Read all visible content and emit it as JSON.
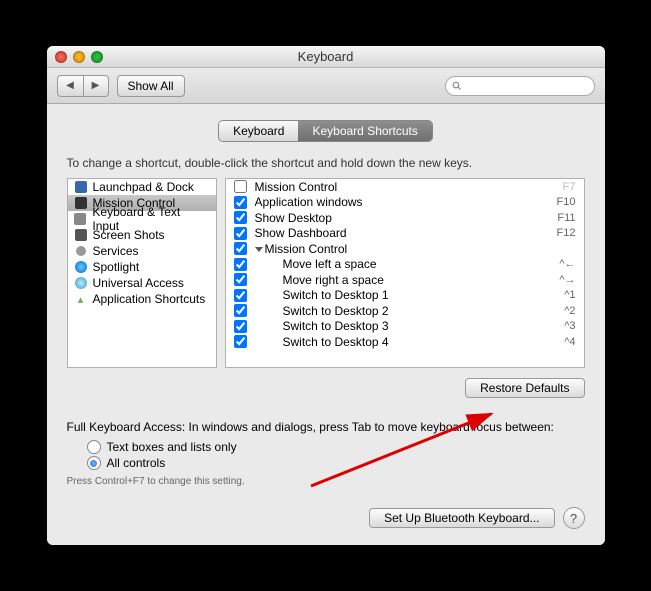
{
  "window": {
    "title": "Keyboard"
  },
  "toolbar": {
    "show_all": "Show All",
    "search_placeholder": ""
  },
  "tabs": {
    "keyboard": "Keyboard",
    "shortcuts": "Keyboard Shortcuts"
  },
  "instruction": "To change a shortcut, double-click the shortcut and hold down the new keys.",
  "categories": [
    {
      "label": "Launchpad & Dock"
    },
    {
      "label": "Mission Control"
    },
    {
      "label": "Keyboard & Text Input"
    },
    {
      "label": "Screen Shots"
    },
    {
      "label": "Services"
    },
    {
      "label": "Spotlight"
    },
    {
      "label": "Universal Access"
    },
    {
      "label": "Application Shortcuts"
    }
  ],
  "shortcuts": [
    {
      "checked": false,
      "label": "Mission Control",
      "key": "F7",
      "disabled": true
    },
    {
      "checked": true,
      "label": "Application windows",
      "key": "F10"
    },
    {
      "checked": true,
      "label": "Show Desktop",
      "key": "F11"
    },
    {
      "checked": true,
      "label": "Show Dashboard",
      "key": "F12"
    },
    {
      "checked": true,
      "label": "Mission Control",
      "key": "",
      "group": true
    },
    {
      "checked": true,
      "label": "Move left a space",
      "key": "^←",
      "indent": true
    },
    {
      "checked": true,
      "label": "Move right a space",
      "key": "^→",
      "indent": true
    },
    {
      "checked": true,
      "label": "Switch to Desktop 1",
      "key": "^1",
      "indent": true
    },
    {
      "checked": true,
      "label": "Switch to Desktop 2",
      "key": "^2",
      "indent": true
    },
    {
      "checked": true,
      "label": "Switch to Desktop 3",
      "key": "^3",
      "indent": true
    },
    {
      "checked": true,
      "label": "Switch to Desktop 4",
      "key": "^4",
      "indent": true
    }
  ],
  "restore_defaults": "Restore Defaults",
  "fka": {
    "label": "Full Keyboard Access: In windows and dialogs, press Tab to move keyboard focus between:",
    "opt1": "Text boxes and lists only",
    "opt2": "All controls",
    "hint": "Press Control+F7 to change this setting."
  },
  "bluetooth": "Set Up Bluetooth Keyboard...",
  "help": "?"
}
